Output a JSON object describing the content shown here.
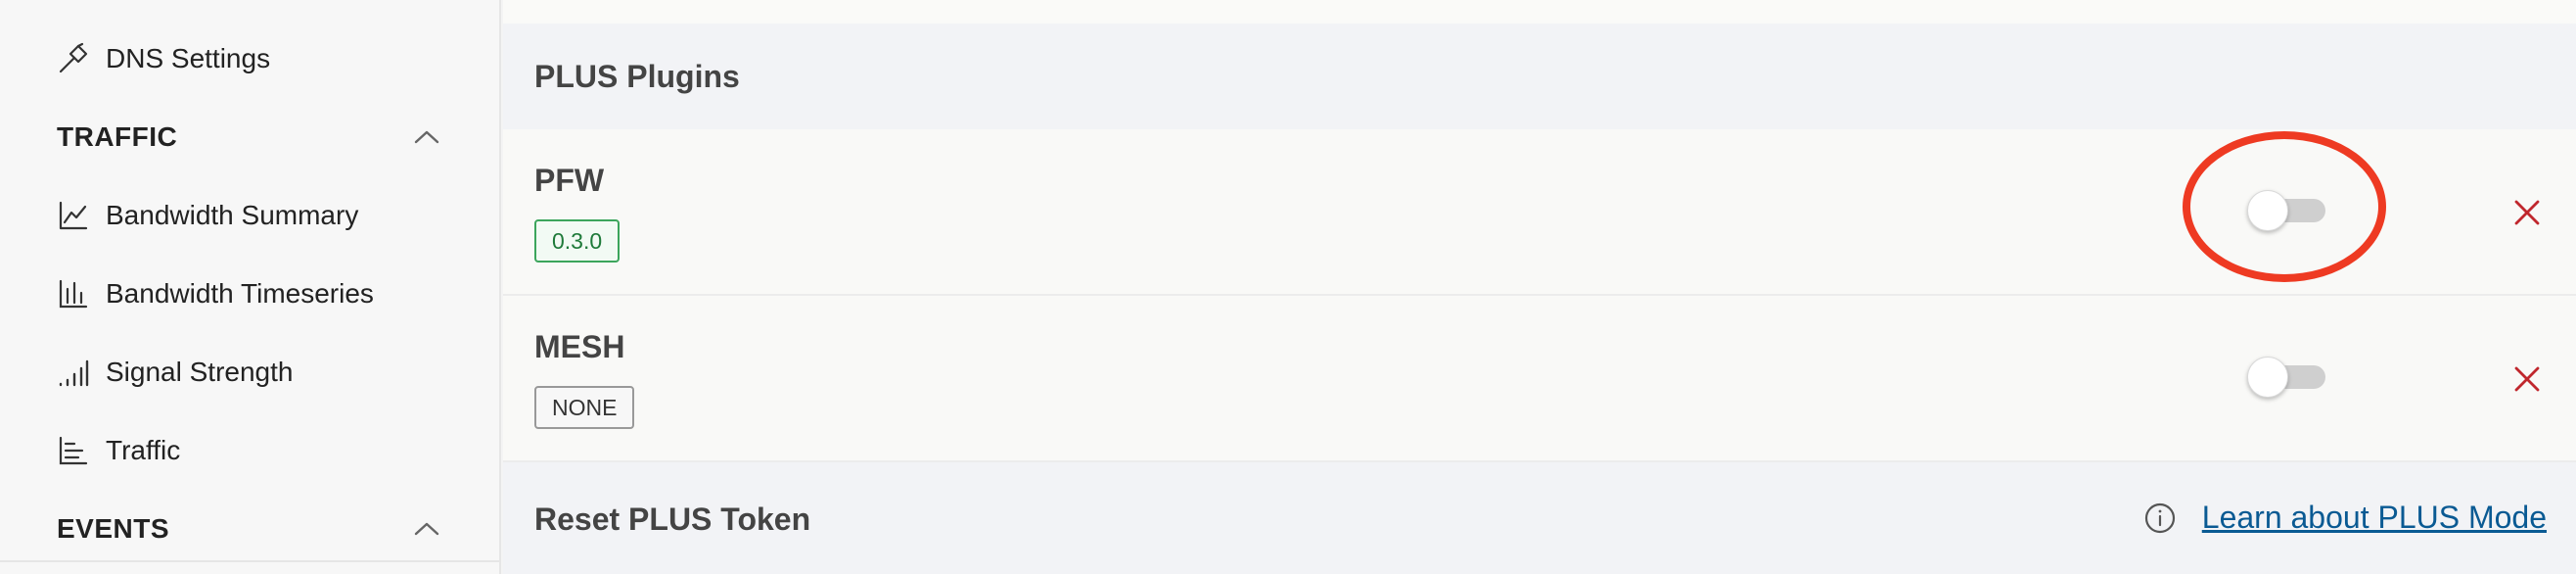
{
  "sidebar": {
    "items_top": [
      {
        "label": "DNS Settings",
        "icon": "hammer-icon"
      }
    ],
    "sections": [
      {
        "title": "TRAFFIC",
        "expanded": true,
        "items": [
          {
            "label": "Bandwidth Summary",
            "icon": "line-chart-icon"
          },
          {
            "label": "Bandwidth Timeseries",
            "icon": "bar-chart-icon"
          },
          {
            "label": "Signal Strength",
            "icon": "signal-bars-icon"
          },
          {
            "label": "Traffic",
            "icon": "stacked-chart-icon"
          }
        ]
      },
      {
        "title": "EVENTS",
        "expanded": true,
        "items": []
      }
    ]
  },
  "main": {
    "plus_plugins": {
      "title": "PLUS Plugins",
      "plugins": [
        {
          "name": "PFW",
          "version": "0.3.0",
          "version_status": "installed",
          "enabled": false
        },
        {
          "name": "MESH",
          "version": "NONE",
          "version_status": "none",
          "enabled": false
        }
      ]
    },
    "reset_token": {
      "title": "Reset PLUS Token",
      "link_label": "Learn about PLUS Mode"
    }
  },
  "colors": {
    "highlight": "#ee3a22",
    "remove": "#c0272d",
    "link": "#0a5a93",
    "version_ok": "#1f7a3a"
  }
}
